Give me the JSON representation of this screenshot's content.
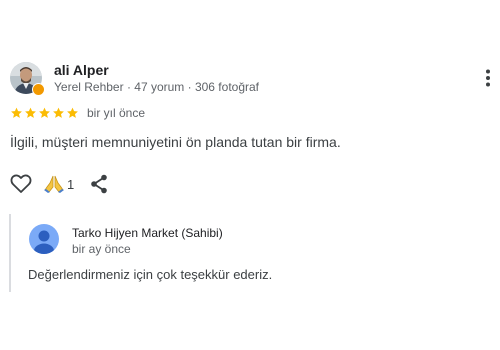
{
  "review": {
    "author": {
      "name": "ali Alper",
      "meta": "Yerel Rehber · 47 yorum · 306 fotoğraf",
      "avatar_icon": "profile-photo",
      "badge_icon": "local-guide-badge-icon"
    },
    "rating": 5,
    "star_color": "#fbbc04",
    "date": "bir yıl önce",
    "text": "İlgili, müşteri memnuniyetini ön planda tutan bir firma.",
    "actions": {
      "like_icon": "heart-icon",
      "thanks_icon": "folded-hands-icon",
      "thanks_count": "1",
      "share_icon": "share-icon",
      "more_icon": "more-vert-icon"
    }
  },
  "owner_reply": {
    "name": "Tarko Hijyen Market (Sahibi)",
    "date": "bir ay önce",
    "text": "Değerlendirmeniz için çok teşekkür ederiz.",
    "avatar_icon": "person-icon",
    "avatar_color": "#7baaf7"
  }
}
